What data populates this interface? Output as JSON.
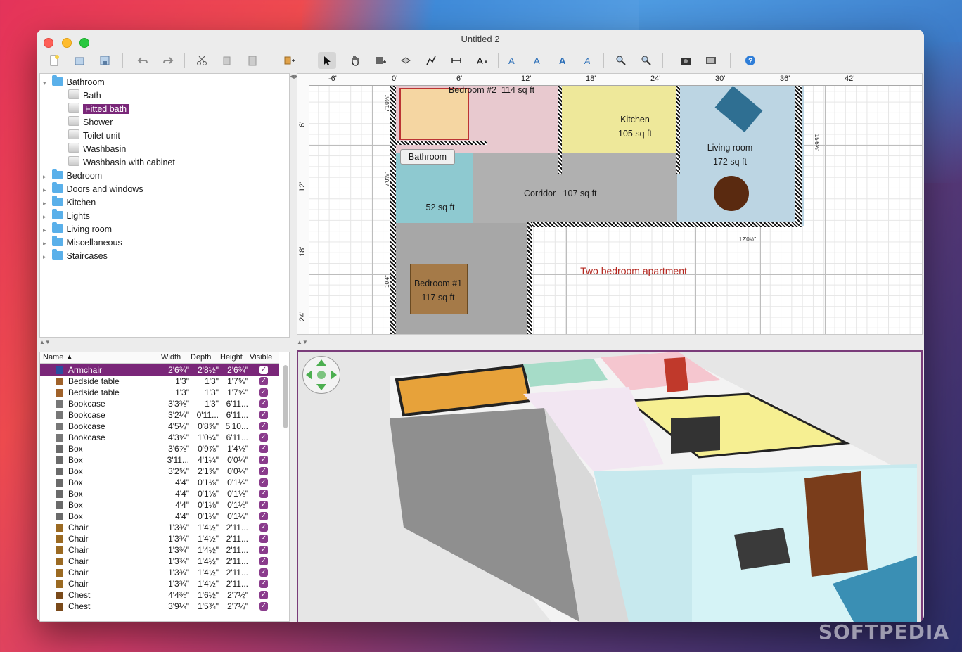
{
  "window": {
    "title": "Untitled 2"
  },
  "catalog": {
    "items": [
      {
        "label": "Bathroom",
        "type": "folder",
        "expanded": true
      },
      {
        "label": "Bath",
        "type": "item"
      },
      {
        "label": "Fitted bath",
        "type": "item",
        "selected": true
      },
      {
        "label": "Shower",
        "type": "item"
      },
      {
        "label": "Toilet unit",
        "type": "item"
      },
      {
        "label": "Washbasin",
        "type": "item"
      },
      {
        "label": "Washbasin with cabinet",
        "type": "item"
      },
      {
        "label": "Bedroom",
        "type": "folder"
      },
      {
        "label": "Doors and windows",
        "type": "folder"
      },
      {
        "label": "Kitchen",
        "type": "folder"
      },
      {
        "label": "Lights",
        "type": "folder"
      },
      {
        "label": "Living room",
        "type": "folder"
      },
      {
        "label": "Miscellaneous",
        "type": "folder"
      },
      {
        "label": "Staircases",
        "type": "folder"
      }
    ]
  },
  "furniture_table": {
    "columns": [
      "Name ▲",
      "Width",
      "Depth",
      "Height",
      "Visible"
    ],
    "rows": [
      {
        "name": "Armchair",
        "width": "2'6¾\"",
        "depth": "2'8½\"",
        "height": "2'6¾\"",
        "visible": true,
        "selected": true
      },
      {
        "name": "Bedside table",
        "width": "1'3\"",
        "depth": "1'3\"",
        "height": "1'7⅝\"",
        "visible": true
      },
      {
        "name": "Bedside table",
        "width": "1'3\"",
        "depth": "1'3\"",
        "height": "1'7⅝\"",
        "visible": true
      },
      {
        "name": "Bookcase",
        "width": "3'3⅜\"",
        "depth": "1'3\"",
        "height": "6'11...",
        "visible": true
      },
      {
        "name": "Bookcase",
        "width": "3'2¼\"",
        "depth": "0'11...",
        "height": "6'11...",
        "visible": true
      },
      {
        "name": "Bookcase",
        "width": "4'5½\"",
        "depth": "0'8⅝\"",
        "height": "5'10...",
        "visible": true
      },
      {
        "name": "Bookcase",
        "width": "4'3⅝\"",
        "depth": "1'0¼\"",
        "height": "6'11...",
        "visible": true
      },
      {
        "name": "Box",
        "width": "3'6⅞\"",
        "depth": "0'9⅞\"",
        "height": "1'4½\"",
        "visible": true
      },
      {
        "name": "Box",
        "width": "3'11...",
        "depth": "4'1¼\"",
        "height": "0'0¼\"",
        "visible": true
      },
      {
        "name": "Box",
        "width": "3'2⅝\"",
        "depth": "2'1⅝\"",
        "height": "0'0¼\"",
        "visible": true
      },
      {
        "name": "Box",
        "width": "4'4\"",
        "depth": "0'1⅛\"",
        "height": "0'1⅛\"",
        "visible": true
      },
      {
        "name": "Box",
        "width": "4'4\"",
        "depth": "0'1⅛\"",
        "height": "0'1⅛\"",
        "visible": true
      },
      {
        "name": "Box",
        "width": "4'4\"",
        "depth": "0'1⅛\"",
        "height": "0'1⅛\"",
        "visible": true
      },
      {
        "name": "Box",
        "width": "4'4\"",
        "depth": "0'1⅛\"",
        "height": "0'1⅛\"",
        "visible": true
      },
      {
        "name": "Chair",
        "width": "1'3¾\"",
        "depth": "1'4½\"",
        "height": "2'11...",
        "visible": true
      },
      {
        "name": "Chair",
        "width": "1'3¾\"",
        "depth": "1'4½\"",
        "height": "2'11...",
        "visible": true
      },
      {
        "name": "Chair",
        "width": "1'3¾\"",
        "depth": "1'4½\"",
        "height": "2'11...",
        "visible": true
      },
      {
        "name": "Chair",
        "width": "1'3¾\"",
        "depth": "1'4½\"",
        "height": "2'11...",
        "visible": true
      },
      {
        "name": "Chair",
        "width": "1'3¾\"",
        "depth": "1'4½\"",
        "height": "2'11...",
        "visible": true
      },
      {
        "name": "Chair",
        "width": "1'3¾\"",
        "depth": "1'4½\"",
        "height": "2'11...",
        "visible": true
      },
      {
        "name": "Chest",
        "width": "4'4⅜\"",
        "depth": "1'6½\"",
        "height": "2'7½\"",
        "visible": true
      },
      {
        "name": "Chest",
        "width": "3'9¼\"",
        "depth": "1'5¾\"",
        "height": "2'7½\"",
        "visible": true
      }
    ]
  },
  "plan": {
    "ruler_top": [
      "-6'",
      "0'",
      "6'",
      "12'",
      "18'",
      "24'",
      "30'",
      "36'",
      "42'"
    ],
    "ruler_left": [
      "6'",
      "12'",
      "18'",
      "24'"
    ],
    "rooms": [
      {
        "name": "Bedroom #2",
        "area": "114 sq ft"
      },
      {
        "name": "Kitchen",
        "area": "105 sq ft"
      },
      {
        "name": "Living room",
        "area": "172 sq ft"
      },
      {
        "name": "Bathroom",
        "area": "52 sq ft"
      },
      {
        "name": "Corridor",
        "area": "107 sq ft"
      },
      {
        "name": "Bedroom #1",
        "area": "117 sq ft"
      }
    ],
    "dimensions": {
      "top_left": "7'10⅜\"",
      "left_mid": "7'0⅝\"",
      "left_bottom": "10'4\"",
      "right": "15'6⅝\"",
      "bottom": "12'0½\""
    },
    "annotation": "Two bedroom apartment"
  },
  "watermark": "SOFTPEDIA",
  "colors": {
    "accent": "#7a2779",
    "room_bedroom2": "#e8c9cf",
    "room_kitchen": "#f0ea98",
    "room_living": "#bcd5e3",
    "room_bath": "#8ec9d0"
  }
}
